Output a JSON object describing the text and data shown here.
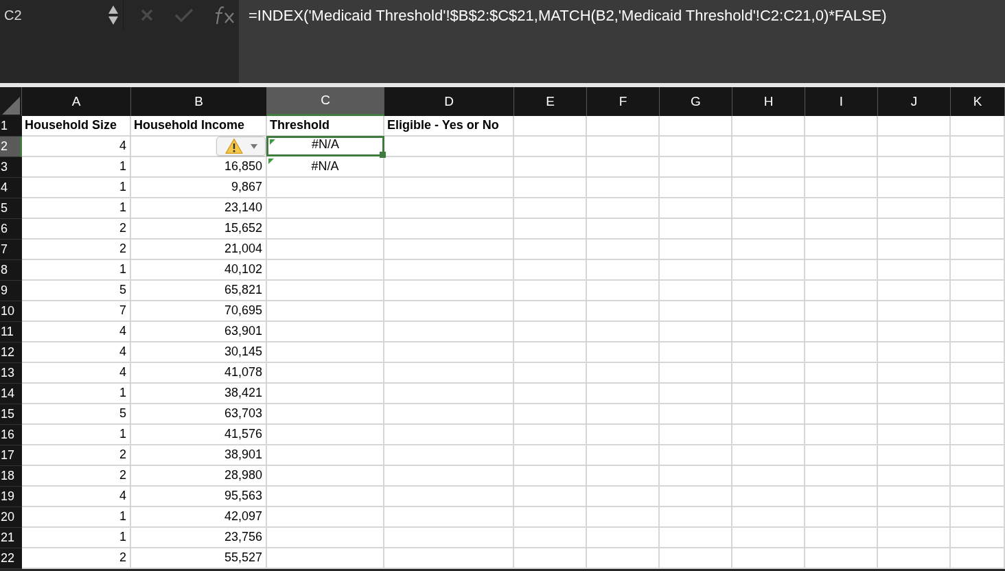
{
  "name_box": "C2",
  "formula_bar": {
    "cancel_disabled": true,
    "formula": "=INDEX('Medicaid Threshold'!$B$2:$C$21,MATCH(B2,'Medicaid Threshold'!C2:C21,0)*FALSE)"
  },
  "columns": [
    {
      "label": "A",
      "selected": false
    },
    {
      "label": "B",
      "selected": false
    },
    {
      "label": "C",
      "selected": true
    },
    {
      "label": "D",
      "selected": false
    },
    {
      "label": "E",
      "selected": false
    },
    {
      "label": "F",
      "selected": false
    },
    {
      "label": "G",
      "selected": false
    },
    {
      "label": "H",
      "selected": false
    },
    {
      "label": "I",
      "selected": false
    },
    {
      "label": "J",
      "selected": false
    },
    {
      "label": "K",
      "selected": false
    }
  ],
  "rows": [
    {
      "number": "1",
      "selected": false,
      "kind": "header",
      "cells": {
        "A": "Household Size",
        "B": "Household Income",
        "C": "Threshold",
        "D": "Eligible - Yes or No"
      }
    },
    {
      "number": "2",
      "selected": true,
      "kind": "data",
      "error_indicator": true,
      "cells": {
        "A": "4",
        "C": "#N/A"
      }
    },
    {
      "number": "3",
      "selected": false,
      "kind": "data",
      "error_indicator": true,
      "cells": {
        "A": "1",
        "B": "16,850",
        "C": "#N/A"
      }
    },
    {
      "number": "4",
      "selected": false,
      "kind": "data",
      "cells": {
        "A": "1",
        "B": "9,867"
      }
    },
    {
      "number": "5",
      "selected": false,
      "kind": "data",
      "cells": {
        "A": "1",
        "B": "23,140"
      }
    },
    {
      "number": "6",
      "selected": false,
      "kind": "data",
      "cells": {
        "A": "2",
        "B": "15,652"
      }
    },
    {
      "number": "7",
      "selected": false,
      "kind": "data",
      "cells": {
        "A": "2",
        "B": "21,004"
      }
    },
    {
      "number": "8",
      "selected": false,
      "kind": "data",
      "cells": {
        "A": "1",
        "B": "40,102"
      }
    },
    {
      "number": "9",
      "selected": false,
      "kind": "data",
      "cells": {
        "A": "5",
        "B": "65,821"
      }
    },
    {
      "number": "10",
      "selected": false,
      "kind": "data",
      "cells": {
        "A": "7",
        "B": "70,695"
      }
    },
    {
      "number": "11",
      "selected": false,
      "kind": "data",
      "cells": {
        "A": "4",
        "B": "63,901"
      }
    },
    {
      "number": "12",
      "selected": false,
      "kind": "data",
      "cells": {
        "A": "4",
        "B": "30,145"
      }
    },
    {
      "number": "13",
      "selected": false,
      "kind": "data",
      "cells": {
        "A": "4",
        "B": "41,078"
      }
    },
    {
      "number": "14",
      "selected": false,
      "kind": "data",
      "cells": {
        "A": "1",
        "B": "38,421"
      }
    },
    {
      "number": "15",
      "selected": false,
      "kind": "data",
      "cells": {
        "A": "5",
        "B": "63,703"
      }
    },
    {
      "number": "16",
      "selected": false,
      "kind": "data",
      "cells": {
        "A": "1",
        "B": "41,576"
      }
    },
    {
      "number": "17",
      "selected": false,
      "kind": "data",
      "cells": {
        "A": "2",
        "B": "38,901"
      }
    },
    {
      "number": "18",
      "selected": false,
      "kind": "data",
      "cells": {
        "A": "2",
        "B": "28,980"
      }
    },
    {
      "number": "19",
      "selected": false,
      "kind": "data",
      "cells": {
        "A": "4",
        "B": "95,563"
      }
    },
    {
      "number": "20",
      "selected": false,
      "kind": "data",
      "cells": {
        "A": "1",
        "B": "42,097"
      }
    },
    {
      "number": "21",
      "selected": false,
      "kind": "data",
      "cells": {
        "A": "1",
        "B": "23,756"
      }
    },
    {
      "number": "22",
      "selected": false,
      "kind": "data",
      "cells": {
        "A": "2",
        "B": "55,527"
      }
    }
  ]
}
